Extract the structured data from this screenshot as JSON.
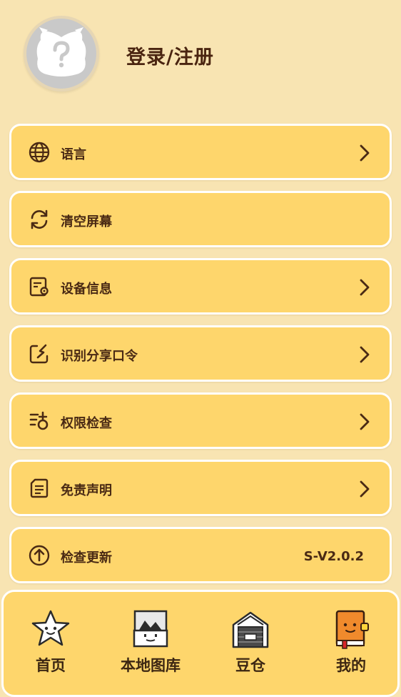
{
  "header": {
    "login_text": "登录/注册",
    "avatar_icon": "unknown-user-avatar-icon"
  },
  "menu": [
    {
      "id": "language",
      "label": "语言",
      "icon": "globe-icon",
      "chevron": true
    },
    {
      "id": "clear-screen",
      "label": "清空屏幕",
      "icon": "refresh-icon",
      "chevron": false
    },
    {
      "id": "device-info",
      "label": "设备信息",
      "icon": "device-settings-icon",
      "chevron": true
    },
    {
      "id": "share-code",
      "label": "识别分享口令",
      "icon": "share-code-icon",
      "chevron": true
    },
    {
      "id": "permission-check",
      "label": "权限检查",
      "icon": "permission-icon",
      "chevron": true
    },
    {
      "id": "disclaimer",
      "label": "免责声明",
      "icon": "document-icon",
      "chevron": true
    },
    {
      "id": "check-update",
      "label": "检查更新",
      "icon": "upload-arrow-icon",
      "version": "S-V2.0.2"
    }
  ],
  "tabbar": [
    {
      "id": "home",
      "label": "首页",
      "icon": "star-mascot-icon"
    },
    {
      "id": "local-gallery",
      "label": "本地图库",
      "icon": "gallery-icon"
    },
    {
      "id": "bean-warehouse",
      "label": "豆仓",
      "icon": "warehouse-icon"
    },
    {
      "id": "mine",
      "label": "我的",
      "icon": "book-mascot-icon"
    }
  ],
  "colors": {
    "background": "#f8e4b2",
    "card": "#fed66c",
    "text": "#4a2a14",
    "card_border": "#ffffff"
  }
}
